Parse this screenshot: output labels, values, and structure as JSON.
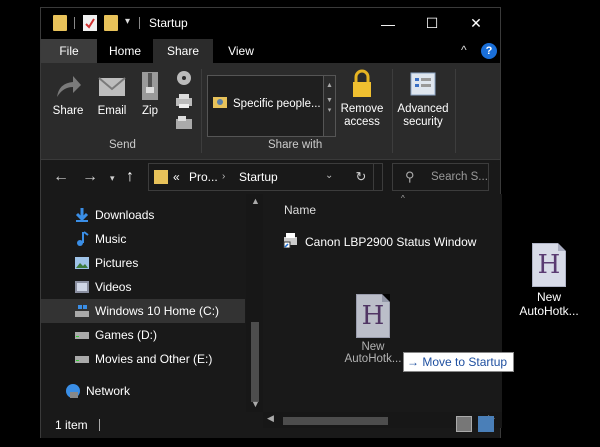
{
  "window": {
    "title": "Startup",
    "controls": {
      "minimize": "—",
      "maximize": "☐",
      "close": "✕"
    }
  },
  "ribbon": {
    "tabs": [
      {
        "label": "File"
      },
      {
        "label": "Home"
      },
      {
        "label": "Share",
        "active": true
      },
      {
        "label": "View"
      }
    ],
    "help_label": "?",
    "send_group": {
      "label": "Send",
      "buttons": [
        {
          "label": "Share",
          "icon": "share-icon"
        },
        {
          "label": "Email",
          "icon": "email-icon"
        },
        {
          "label": "Zip",
          "icon": "zip-icon"
        }
      ]
    },
    "share_with_group": {
      "label": "Share with",
      "dropdown_value": "Specific people...",
      "remove_access": "Remove access",
      "advanced_security": "Advanced security"
    }
  },
  "address_bar": {
    "overflow": "«",
    "segments": [
      "Pro...",
      "Startup"
    ],
    "search_placeholder": "Search S..."
  },
  "nav_pane": {
    "items": [
      {
        "label": "Downloads",
        "icon": "download-arrow-icon"
      },
      {
        "label": "Music",
        "icon": "music-note-icon"
      },
      {
        "label": "Pictures",
        "icon": "pictures-icon"
      },
      {
        "label": "Videos",
        "icon": "videos-icon"
      },
      {
        "label": "Windows 10 Home (C:)",
        "icon": "windows-drive-icon",
        "selected": true
      },
      {
        "label": "Games (D:)",
        "icon": "drive-icon"
      },
      {
        "label": "Movies and Other (E:)",
        "icon": "drive-icon"
      },
      {
        "label": "Network",
        "icon": "network-icon"
      }
    ]
  },
  "content": {
    "column_header": "Name",
    "files": [
      {
        "name": "Canon LBP2900 Status Window",
        "icon": "shortcut-printer-icon"
      }
    ],
    "drag_ghost": {
      "line1": "New",
      "line2": "AutoHotk..."
    },
    "tooltip": "→ Move to Startup"
  },
  "status_bar": {
    "item_count": "1 item"
  },
  "desktop": {
    "icon_line1": "New",
    "icon_line2": "AutoHotk...",
    "icon_glyph": "H"
  },
  "colors": {
    "accent_blue": "#1a6fd9",
    "folder_yellow": "#e8c25a",
    "ahk_purple": "#5a3b72"
  }
}
